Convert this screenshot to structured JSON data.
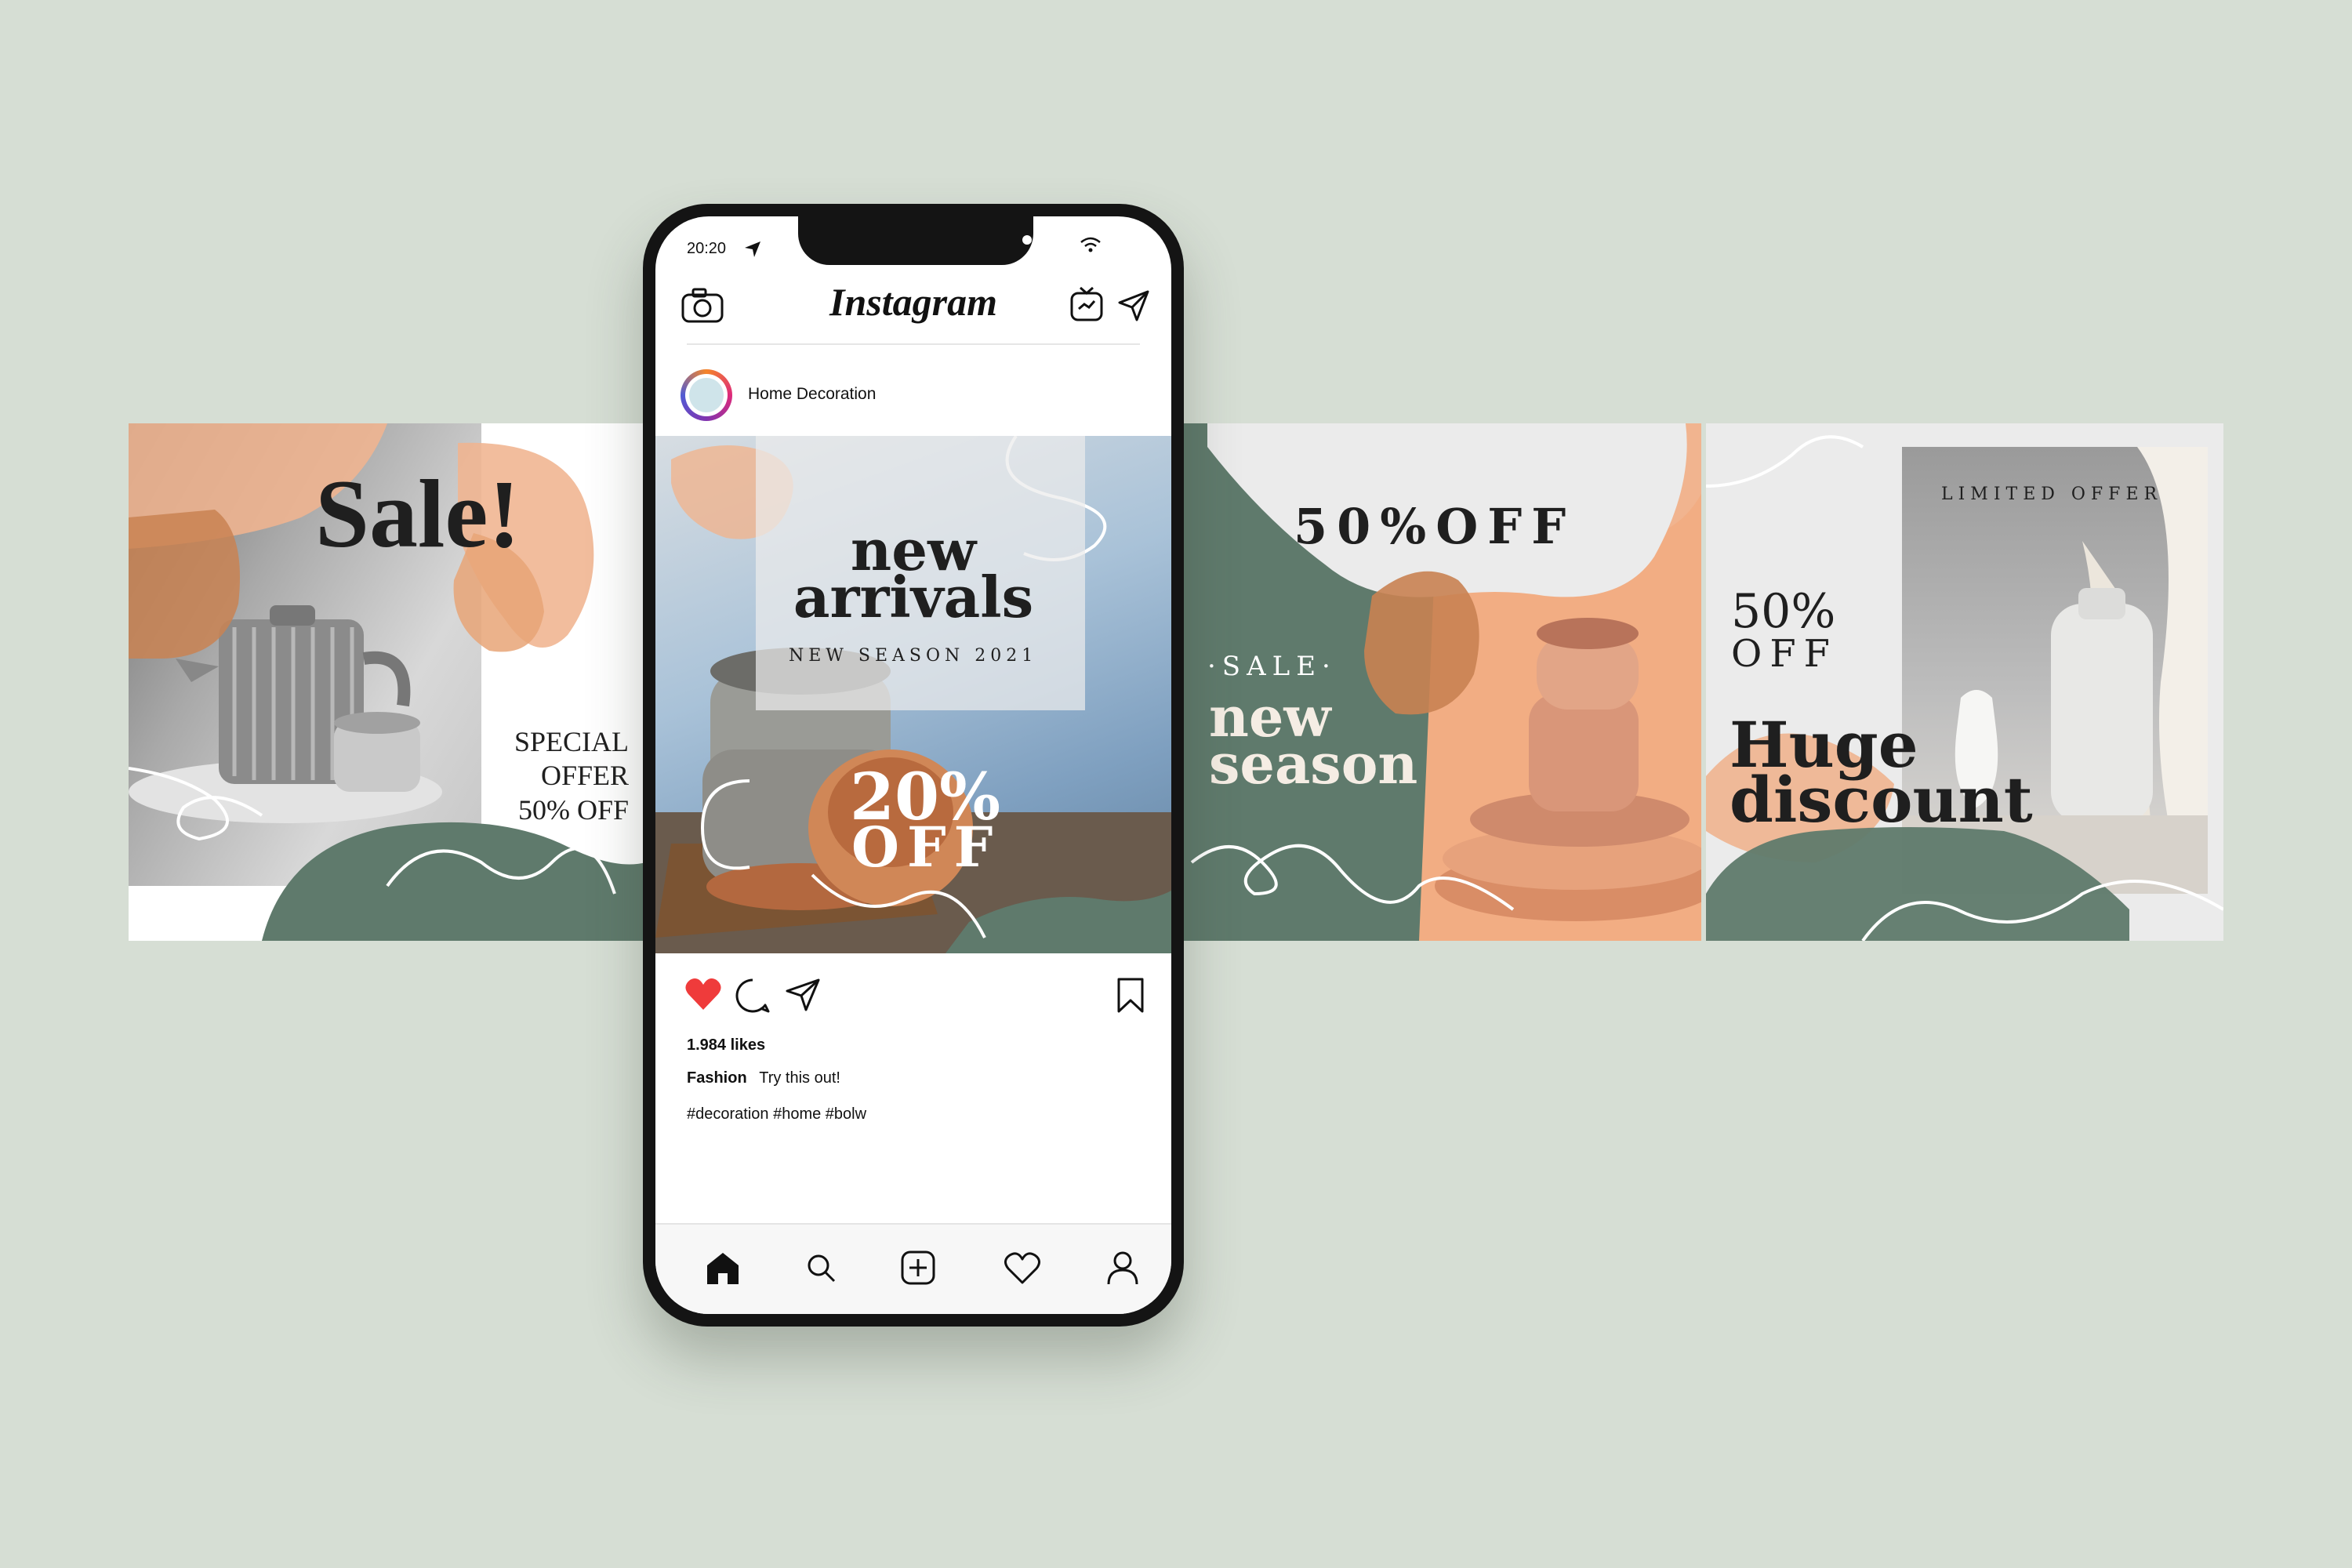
{
  "status_bar": {
    "time": "20:20"
  },
  "app": {
    "name": "Instagram"
  },
  "post": {
    "username": "Home Decoration",
    "likes": "1.984 likes",
    "caption_user": "Fashion",
    "caption_text": "Try this out!",
    "hashtags": "#decoration #home #bolw"
  },
  "slides": [
    {
      "title": "Sale!",
      "offer_line1": "SPECIAL",
      "offer_line2": "OFFER",
      "offer_line3": "50% OFF"
    },
    {
      "title_line1": "new",
      "title_line2": "arrivals",
      "subtitle": "NEW SEASON 2021",
      "discount_line1": "20%",
      "discount_line2": "OFF"
    },
    {
      "headline": "50%OFF",
      "tag": "·SALE·",
      "title_line1": "new",
      "title_line2": "season"
    },
    {
      "kicker": "LIMITED OFFER",
      "discount_line1": "50%",
      "discount_line2": "OFF",
      "title_line1": "Huge",
      "title_line2": "discount"
    }
  ],
  "bottom_nav": [
    "home-icon",
    "search-icon",
    "add-post-icon",
    "activity-heart-icon",
    "profile-icon"
  ],
  "colors": {
    "background": "#d6ded4",
    "sage": "#5f7a6c",
    "peach": "#f0b48f",
    "terracotta": "#c98252",
    "like_red": "#ef3b3b"
  }
}
